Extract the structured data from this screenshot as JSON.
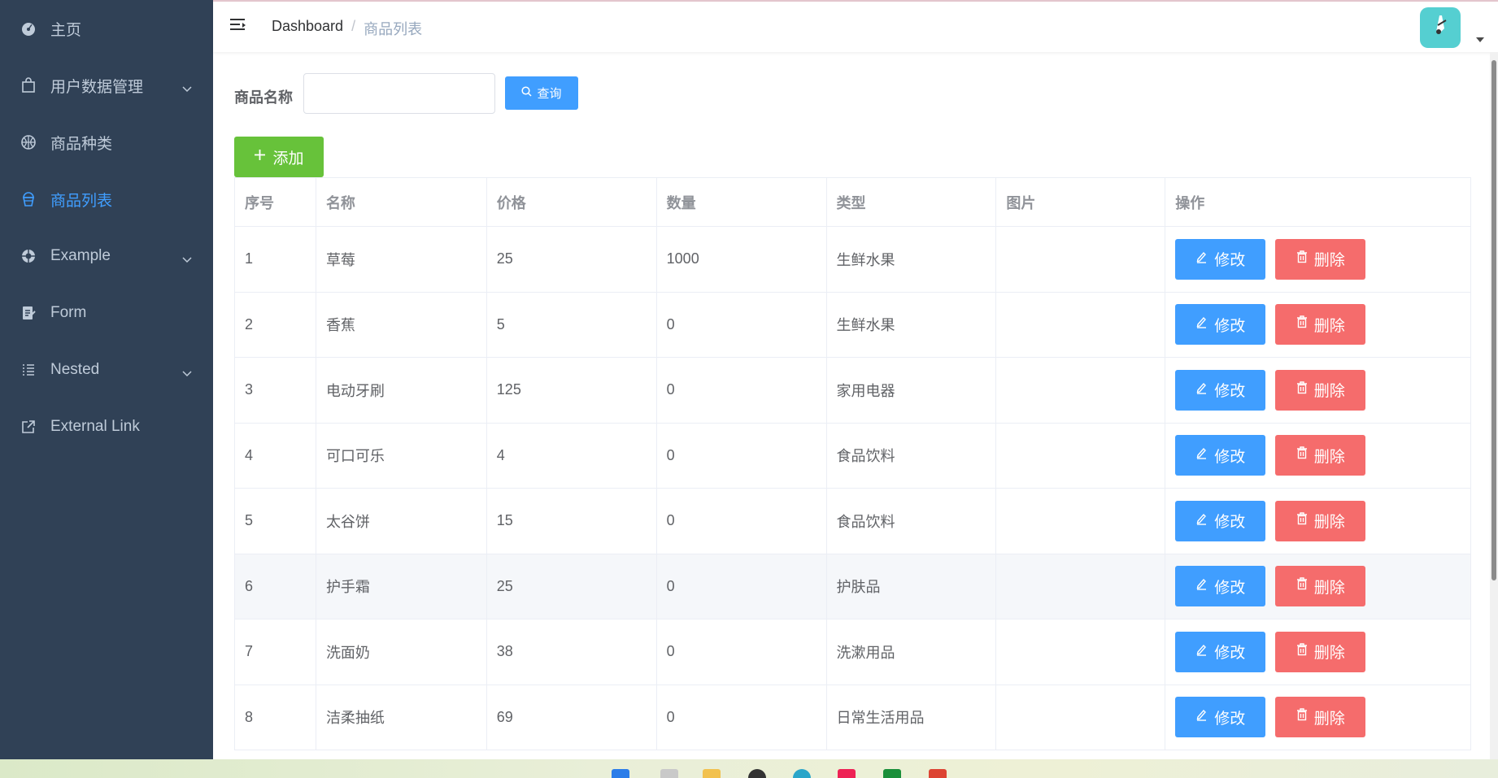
{
  "sidebar": {
    "items": [
      {
        "label": "主页",
        "icon": "dashboard-icon",
        "has_children": false,
        "active": false
      },
      {
        "label": "用户数据管理",
        "icon": "shopping-bag-icon",
        "has_children": true,
        "active": false
      },
      {
        "label": "商品种类",
        "icon": "basketball-icon",
        "has_children": false,
        "active": false
      },
      {
        "label": "商品列表",
        "icon": "ice-cream-icon",
        "has_children": false,
        "active": true
      },
      {
        "label": "Example",
        "icon": "lifebuoy-icon",
        "has_children": true,
        "active": false
      },
      {
        "label": "Form",
        "icon": "form-icon",
        "has_children": false,
        "active": false
      },
      {
        "label": "Nested",
        "icon": "list-icon",
        "has_children": true,
        "active": false
      },
      {
        "label": "External Link",
        "icon": "external-link-icon",
        "has_children": false,
        "active": false
      }
    ]
  },
  "navbar": {
    "breadcrumb_home": "Dashboard",
    "breadcrumb_sep": "/",
    "breadcrumb_current": "商品列表"
  },
  "filter": {
    "label": "商品名称",
    "value": "",
    "placeholder": "",
    "search_label": "查询"
  },
  "add_label": "添加",
  "table": {
    "headers": [
      "序号",
      "名称",
      "价格",
      "数量",
      "类型",
      "图片",
      "操作"
    ],
    "edit_label": "修改",
    "delete_label": "删除",
    "rows": [
      [
        "1",
        "草莓",
        "25",
        "1000",
        "生鲜水果",
        ""
      ],
      [
        "2",
        "香蕉",
        "5",
        "0",
        "生鲜水果",
        ""
      ],
      [
        "3",
        "电动牙刷",
        "125",
        "0",
        "家用电器",
        ""
      ],
      [
        "4",
        "可口可乐",
        "4",
        "0",
        "食品饮料",
        ""
      ],
      [
        "5",
        "太谷饼",
        "15",
        "0",
        "食品饮料",
        ""
      ],
      [
        "6",
        "护手霜",
        "25",
        "0",
        "护肤品",
        ""
      ],
      [
        "7",
        "洗面奶",
        "38",
        "0",
        "洗漱用品",
        ""
      ],
      [
        "8",
        "洁柔抽纸",
        "69",
        "0",
        "日常生活用品",
        ""
      ]
    ],
    "highlighted_row": 5
  },
  "colors": {
    "sidebar_bg": "#304156",
    "primary": "#409eff",
    "success": "#67c23a",
    "danger": "#f56c6c"
  }
}
